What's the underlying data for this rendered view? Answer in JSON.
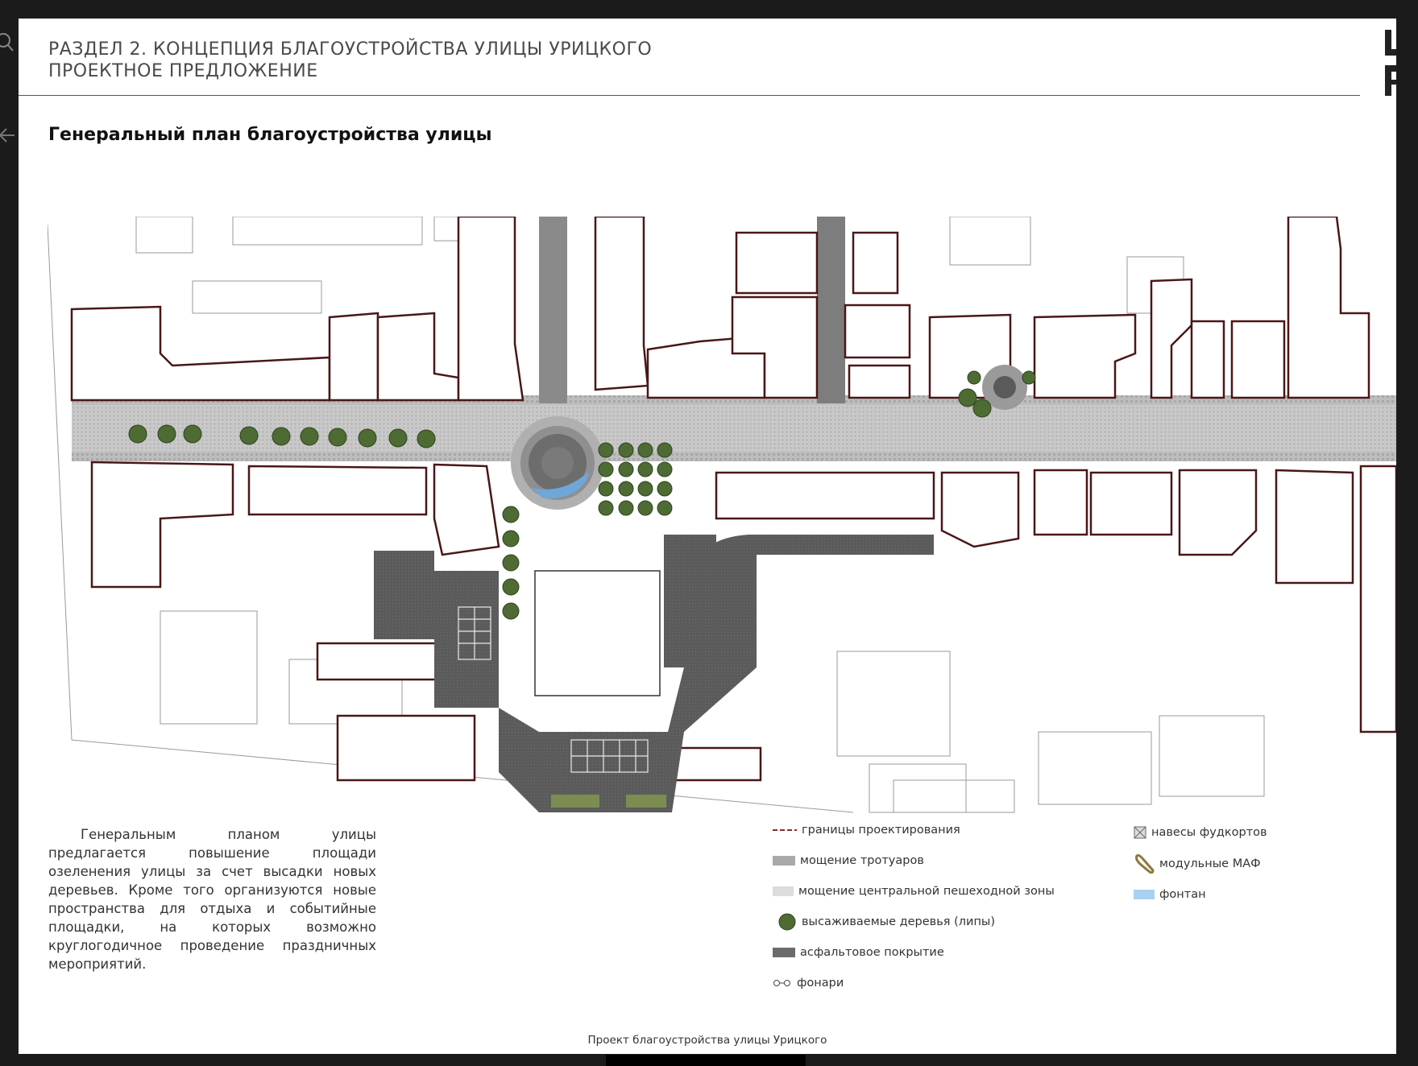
{
  "header": {
    "section_line1": "РАЗДЕЛ 2. КОНЦЕПЦИЯ БЛАГОУСТРОЙСТВА УЛИЦЫ УРИЦКОГО",
    "section_line2": "ПРОЕКТНОЕ ПРЕДЛОЖЕНИЕ",
    "logo_text": "U\nP"
  },
  "title": "Генеральный план благоустройства улицы",
  "description": "Генеральным планом улицы предлагается повышение площади озеленения улицы за счет высадки новых деревьев. Кроме того организуются новые пространства для отдыха и событийные площадки, на которых возможно круглогодичное проведение праздничных мероприятий.",
  "legend": {
    "left": [
      {
        "label": "границы проектирования",
        "icon": "boundary-dash",
        "color": "#8b2a2a"
      },
      {
        "label": "мощение тротуаров",
        "icon": "sidewalk-paving"
      },
      {
        "label": "мощение центральной пешеходной зоны",
        "icon": "central-paving"
      },
      {
        "label": "высаживаемые деревья (липы)",
        "icon": "tree"
      },
      {
        "label": "асфальтовое покрытие",
        "icon": "asphalt",
        "color": "#6b6b6b"
      },
      {
        "label": "фонари",
        "icon": "lamp"
      }
    ],
    "right": [
      {
        "label": "навесы фудкортов",
        "icon": "canopy"
      },
      {
        "label": "модульные МАФ",
        "icon": "maf"
      },
      {
        "label": "фонтан",
        "icon": "fountain",
        "color": "#a9d0ee"
      }
    ]
  },
  "footer": "Проект благоустройства улицы Урицкого",
  "colors": {
    "building_outline": "#5a1a1a",
    "street": "#c9c9c9",
    "sidewalk": "#9d9d9d",
    "asphalt": "#555555",
    "tree": "#5d7a3e"
  }
}
